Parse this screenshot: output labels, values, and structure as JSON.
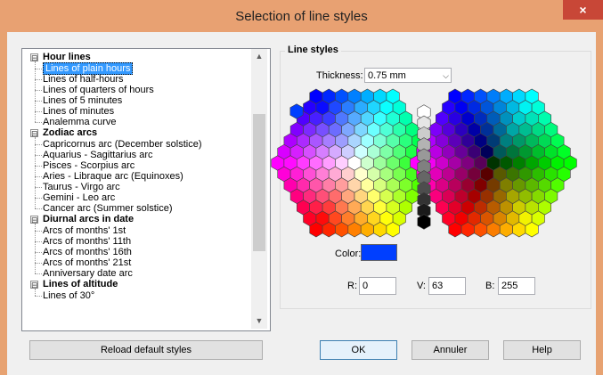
{
  "window": {
    "title": "Selection of line styles",
    "close_glyph": "×"
  },
  "tree": {
    "groups": [
      {
        "label": "Hour lines",
        "expander": "⊟",
        "children": [
          "Lines of plain hours",
          "Lines of half-hours",
          "Lines of quarters of hours",
          "Lines of 5 minutes",
          "Lines of minutes",
          "Analemma curve"
        ]
      },
      {
        "label": "Zodiac arcs",
        "expander": "⊟",
        "children": [
          "Capricornus arc (December solstice)",
          "Aquarius - Sagittarius arc",
          "Pisces - Scorpius arc",
          "Aries - Libraque arc (Equinoxes)",
          "Taurus - Virgo arc",
          "Gemini - Leo arc",
          "Cancer arc (Summer solstice)"
        ]
      },
      {
        "label": "Diurnal arcs in date",
        "expander": "⊟",
        "children": [
          "Arcs of months' 1st",
          "Arcs of months' 11th",
          "Arcs of months' 16th",
          "Arcs of months' 21st",
          "Anniversary date arc"
        ]
      },
      {
        "label": "Lines of altitude",
        "expander": "⊟",
        "children": [
          "Lines of 30°"
        ]
      }
    ],
    "selected": "Lines of plain hours"
  },
  "scrollbar": {
    "up": "▲",
    "down": "▼"
  },
  "line_styles": {
    "title": "Line styles",
    "thickness_label": "Thickness:",
    "thickness_value": "0.75 mm",
    "dropdown_glyph": "⌵",
    "color_label": "Color:",
    "color_value": "#003fff",
    "r_label": "R:",
    "r_value": "0",
    "v_label": "V:",
    "v_value": "63",
    "b_label": "B:",
    "b_value": "255"
  },
  "buttons": {
    "reload": "Reload default styles",
    "ok": "OK",
    "cancel": "Annuler",
    "help": "Help"
  }
}
